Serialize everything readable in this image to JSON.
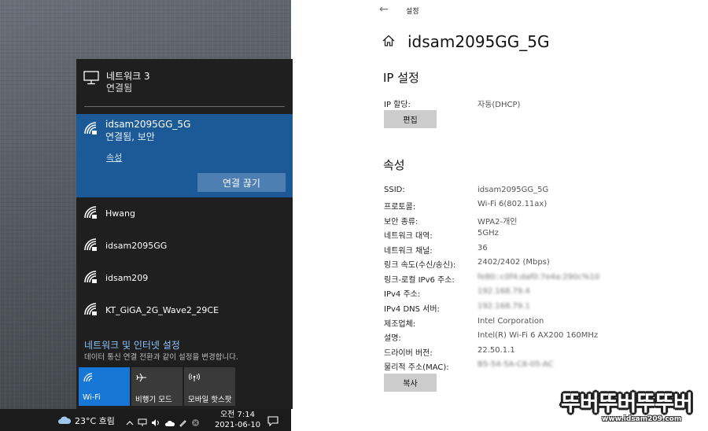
{
  "flyout": {
    "ethernet": {
      "name": "네트워크 3",
      "status": "연결됨",
      "icon": "desktop-pc-icon"
    },
    "active_network": {
      "ssid": "idsam2095GG_5G",
      "status": "연결됨, 보안",
      "properties_link": "속성",
      "disconnect_label": "연결 끊기"
    },
    "networks": [
      {
        "ssid": "Hwang"
      },
      {
        "ssid": "idsam2095GG"
      },
      {
        "ssid": "idsam209"
      },
      {
        "ssid": "KT_GiGA_2G_Wave2_29CE"
      }
    ],
    "settings_link": "네트워크 및 인터넷 설정",
    "settings_sub": "데이터 통신 연결 전환과 같이 설정을 변경합니다.",
    "tiles": [
      {
        "label": "Wi-Fi",
        "icon": "wifi-icon",
        "active": true
      },
      {
        "label": "비행기 모드",
        "icon": "airplane-icon",
        "active": false
      },
      {
        "label": "모바일 핫스팟",
        "icon": "hotspot-icon",
        "active": false
      }
    ]
  },
  "taskbar": {
    "weather": "23°C 흐림",
    "time": "오전 7:14",
    "date": "2021-06-10"
  },
  "settings": {
    "app_title": "설정",
    "page_title": "idsam2095GG_5G",
    "ip_heading": "IP 설정",
    "ip_assign_label": "IP 할당:",
    "ip_assign_value": "자동(DHCP)",
    "edit_label": "편집",
    "properties_heading": "속성",
    "properties": [
      {
        "label": "SSID:",
        "value": "idsam2095GG_5G"
      },
      {
        "label": "프로토콜:",
        "value": "Wi-Fi 6(802.11ax)"
      },
      {
        "label": "보안 종류:",
        "value": "WPA2-개인"
      },
      {
        "label": "네트워크 대역:",
        "value": "5GHz"
      },
      {
        "label": "네트워크 채널:",
        "value": "36"
      },
      {
        "label": "링크 속도(수신/송신):",
        "value": "2402/2402 (Mbps)"
      },
      {
        "label": "링크-로컬 IPv6 주소:",
        "value": "fe80::c0f4:daf0:7e4a:290c%10"
      },
      {
        "label": "IPv4 주소:",
        "value": "192.168.79.4"
      },
      {
        "label": "IPv4 DNS 서버:",
        "value": "192.168.79.1"
      },
      {
        "label": "제조업체:",
        "value": "Intel Corporation"
      },
      {
        "label": "설명:",
        "value": "Intel(R) Wi-Fi 6 AX200 160MHz"
      },
      {
        "label": "드라이버 버전:",
        "value": "22.50.1.1"
      },
      {
        "label": "물리적 주소(MAC):",
        "value": "B5-54-5A-C8-05-AC"
      }
    ],
    "copy_label": "복사"
  },
  "watermark": {
    "text": "뚜버뚜버뚜뚜버",
    "url": "www.idsam209.com"
  }
}
